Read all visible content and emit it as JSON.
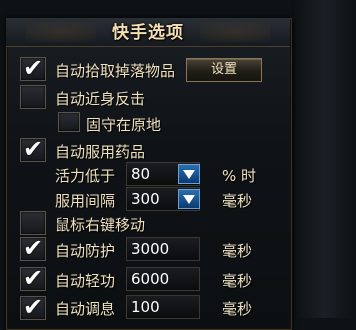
{
  "window": {
    "title": "快手选项"
  },
  "options": {
    "auto_pickup": {
      "label": "自动拾取掉落物品",
      "checked": true,
      "button": "设置"
    },
    "auto_approach": {
      "label": "自动近身反击",
      "checked": false
    },
    "hold_position": {
      "label": "固守在原地",
      "checked": false
    },
    "auto_potion": {
      "label": "自动服用药品",
      "checked": true
    },
    "vitality_below": {
      "label": "活力低于",
      "value": "80",
      "unit": "% 时"
    },
    "use_interval": {
      "label": "服用间隔",
      "value": "300",
      "unit": "毫秒"
    },
    "right_click_move": {
      "label": "鼠标右键移动",
      "checked": false
    },
    "auto_defense": {
      "label": "自动防护",
      "checked": true,
      "value": "3000",
      "unit": "毫秒"
    },
    "auto_qinggong": {
      "label": "自动轻功",
      "checked": true,
      "value": "6000",
      "unit": "毫秒"
    },
    "auto_breath": {
      "label": "自动调息",
      "checked": true,
      "value": "100",
      "unit": "毫秒"
    }
  },
  "colors": {
    "accent": "#2a6fb0",
    "text": "#efe0be",
    "title": "#f3dfb0"
  }
}
